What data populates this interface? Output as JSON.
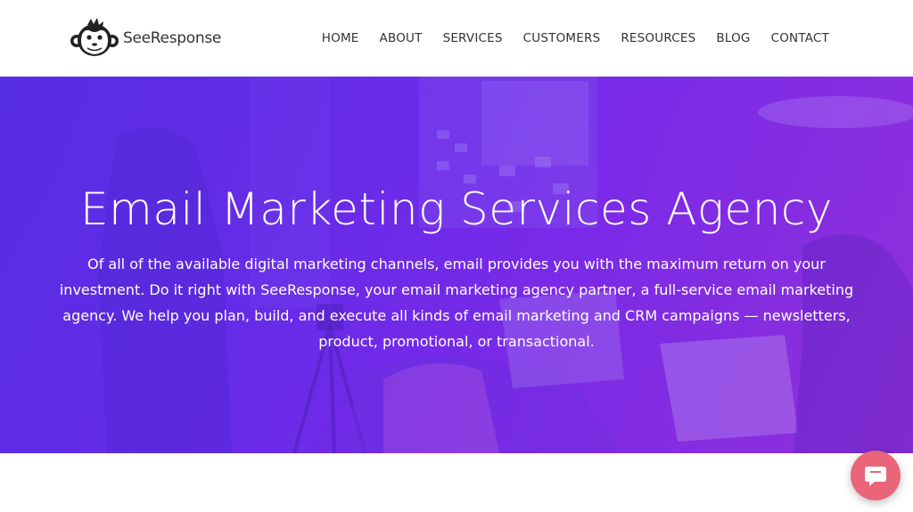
{
  "brand": {
    "name": "SeeResponse",
    "logo_icon": "monkey-head-icon"
  },
  "nav": {
    "items": [
      {
        "label": "HOME"
      },
      {
        "label": "ABOUT"
      },
      {
        "label": "SERVICES"
      },
      {
        "label": "CUSTOMERS"
      },
      {
        "label": "RESOURCES"
      },
      {
        "label": "BLOG"
      },
      {
        "label": "CONTACT"
      }
    ]
  },
  "hero": {
    "title": "Email Marketing Services Agency",
    "description": "Of all of the available digital marketing channels, email provides you with the maximum return on your investment. Do it right with SeeResponse, your email marketing agency partner, a full-service email marketing agency. We help you plan, build, and execute all kinds of email marketing and CRM campaigns — newsletters, product, promotional, or transactional."
  },
  "chat": {
    "icon": "chat-bubble-icon",
    "color": "#e8657a"
  },
  "colors": {
    "hero_start": "#5a2fe0",
    "hero_end": "#8a2fd8"
  }
}
